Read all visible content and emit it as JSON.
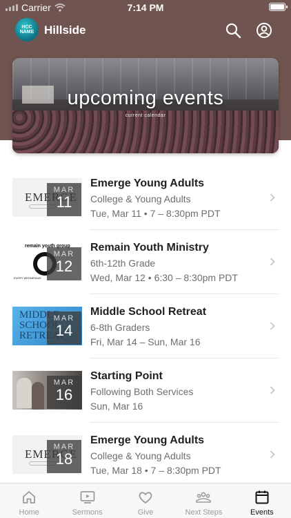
{
  "status_bar": {
    "carrier": "Carrier",
    "time": "7:14 PM"
  },
  "header": {
    "app_name": "Hillside",
    "logo_text": "HCC NAME"
  },
  "hero": {
    "title": "upcoming events",
    "subtitle": "current calendar"
  },
  "events": [
    {
      "title": "Emerge Young Adults",
      "subtitle": "College & Young Adults",
      "time": "Tue, Mar 11 • 7 – 8:30pm PDT",
      "month": "MAR",
      "day": "11",
      "thumb_text": "EMERGE"
    },
    {
      "title": "Remain Youth Ministry",
      "subtitle": "6th-12th Grade",
      "time": "Wed, Mar 12 • 6:30 – 8:30pm PDT",
      "month": "MAR",
      "day": "12",
      "thumb_text": "remain youth group",
      "thumb_text_bottom": "EVERY WEDNESDAY"
    },
    {
      "title": "Middle School Retreat",
      "subtitle": "6-8th Graders",
      "time": "Fri, Mar 14 – Sun, Mar 16",
      "month": "MAR",
      "day": "14",
      "thumb_text": "MIDDLE SCHOOL RETREAT"
    },
    {
      "title": "Starting Point",
      "subtitle": "Following Both Services",
      "time": "Sun, Mar 16",
      "month": "MAR",
      "day": "16"
    },
    {
      "title": "Emerge Young Adults",
      "subtitle": "College & Young Adults",
      "time": "Tue, Mar 18 • 7 – 8:30pm PDT",
      "month": "MAR",
      "day": "18",
      "thumb_text": "EMERGE"
    }
  ],
  "tabs": [
    {
      "label": "Home",
      "icon": "home-icon",
      "active": false
    },
    {
      "label": "Sermons",
      "icon": "video-icon",
      "active": false
    },
    {
      "label": "Give",
      "icon": "heart-icon",
      "active": false
    },
    {
      "label": "Next Steps",
      "icon": "group-icon",
      "active": false
    },
    {
      "label": "Events",
      "icon": "calendar-icon",
      "active": true
    }
  ],
  "colors": {
    "header_bg": "#6f5450",
    "active_tab": "#111111",
    "inactive_tab": "#9a9a9a"
  }
}
